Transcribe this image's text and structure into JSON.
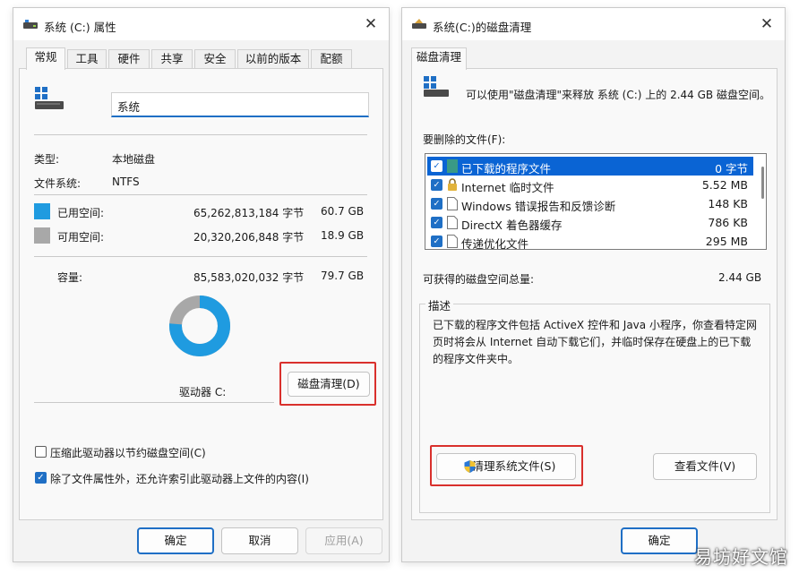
{
  "colors": {
    "used": "#1f9be0",
    "free": "#a8a8a8",
    "accent": "#1f6fc5",
    "highlight_box": "#d9302c"
  },
  "props_window": {
    "title": "系统 (C:) 属性",
    "tabs": [
      "常规",
      "工具",
      "硬件",
      "共享",
      "安全",
      "以前的版本",
      "配额"
    ],
    "drive_name_value": "系统",
    "type_label": "类型:",
    "type_value": "本地磁盘",
    "fs_label": "文件系统:",
    "fs_value": "NTFS",
    "used": {
      "label": "已用空间:",
      "bytes": "65,262,813,184 字节",
      "gb": "60.7 GB"
    },
    "free": {
      "label": "可用空间:",
      "bytes": "20,320,206,848 字节",
      "gb": "18.9 GB"
    },
    "capacity": {
      "label": "容量:",
      "bytes": "85,583,020,032 字节",
      "gb": "79.7 GB"
    },
    "donut_used_fraction": 0.762,
    "drive_label": "驱动器 C:",
    "cleanup_button": "磁盘清理(D)",
    "compress_checkbox": {
      "label": "压缩此驱动器以节约磁盘空间(C)",
      "checked": false
    },
    "index_checkbox": {
      "label": "除了文件属性外，还允许索引此驱动器上文件的内容(I)",
      "checked": true
    },
    "ok_button": "确定",
    "cancel_button": "取消",
    "apply_button": "应用(A)"
  },
  "cleanup_window": {
    "title": "系统(C:)的磁盘清理",
    "tab": "磁盘清理",
    "intro": "可以使用\"磁盘清理\"来释放 系统 (C:) 上的 2.44 GB 磁盘空间。",
    "files_label": "要删除的文件(F):",
    "files": [
      {
        "name": "已下载的程序文件",
        "size": "0 字节",
        "checked": true,
        "selected": true,
        "icon": "folder-icon"
      },
      {
        "name": "Internet 临时文件",
        "size": "5.52 MB",
        "checked": true,
        "selected": false,
        "icon": "lock-icon"
      },
      {
        "name": "Windows 错误报告和反馈诊断",
        "size": "148 KB",
        "checked": true,
        "selected": false,
        "icon": "file-icon"
      },
      {
        "name": "DirectX 着色器缓存",
        "size": "786 KB",
        "checked": true,
        "selected": false,
        "icon": "file-icon"
      },
      {
        "name": "传递优化文件",
        "size": "295 MB",
        "checked": true,
        "selected": false,
        "icon": "file-icon"
      }
    ],
    "total_label": "可获得的磁盘空间总量:",
    "total_value": "2.44 GB",
    "desc_label": "描述",
    "desc_lines": [
      "已下载的程序文件包括 ActiveX 控件和 Java 小程序，你查看特定网",
      "页时将会从 Internet 自动下载它们，并临时保存在硬盘上的已下载",
      "的程序文件夹中。"
    ],
    "clean_system_button": "清理系统文件(S)",
    "view_files_button": "查看文件(V)",
    "ok_button": "确定",
    "shield_icon": "uac-shield-icon"
  },
  "watermark": "易坊好文馆"
}
